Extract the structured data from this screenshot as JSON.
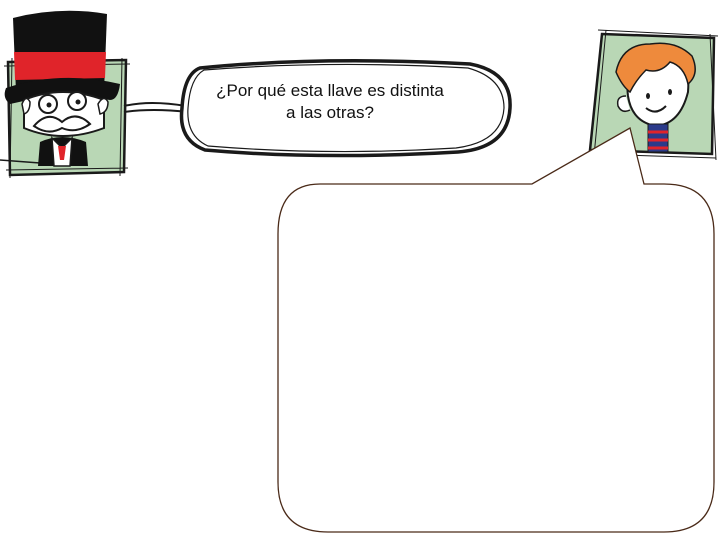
{
  "dialogue": {
    "question_line1": "¿Por qué esta llave es distinta",
    "question_line2": "a las otras?",
    "answer_text": ""
  },
  "colors": {
    "portrait_bg": "#b9d7b5",
    "hat": "#111111",
    "hat_band": "#e0242a",
    "boy_hair": "#ee8a3c",
    "outline": "#1a1a1a",
    "answer_bubble_stroke": "#4a2a18"
  },
  "icons": {
    "left_character": "gentleman-top-hat-icon",
    "right_character": "boy-orange-hair-icon"
  }
}
